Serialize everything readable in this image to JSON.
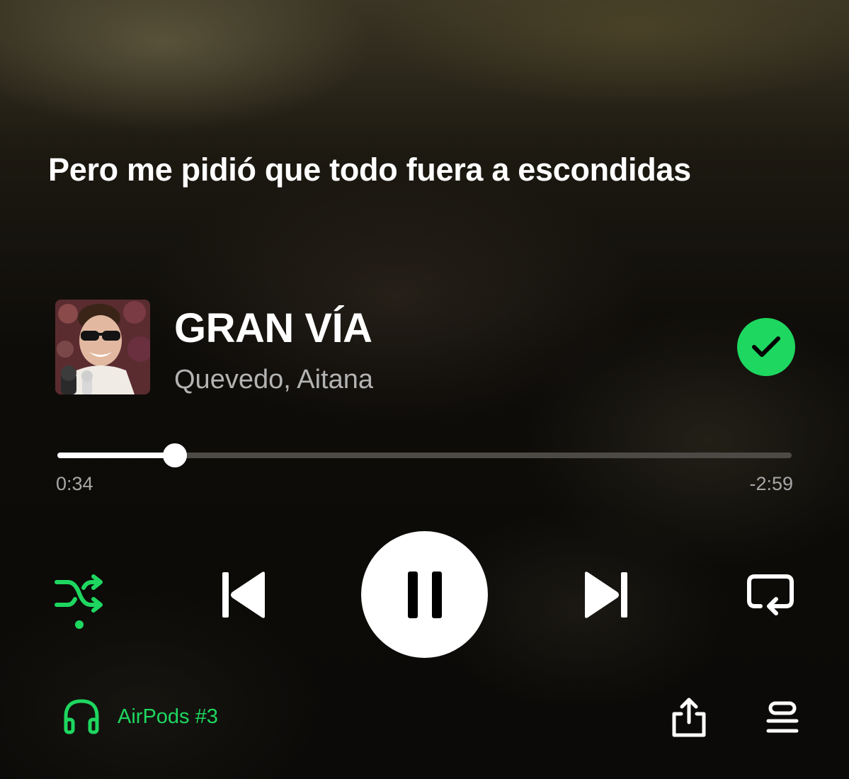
{
  "lyrics": {
    "current_line": "Pero me pidió que todo fuera a escondidas"
  },
  "now_playing": {
    "title": "GRAN VÍA",
    "artist": "Quevedo, Aitana",
    "liked": true,
    "cover_icon": "album-cover-image"
  },
  "playback": {
    "elapsed": "0:34",
    "remaining": "-2:59",
    "progress_fraction": 0.16,
    "state": "playing",
    "shuffle_enabled": true,
    "repeat_enabled": false
  },
  "controls": {
    "shuffle_icon": "shuffle-icon",
    "previous_icon": "skip-previous-icon",
    "pause_icon": "pause-icon",
    "next_icon": "skip-next-icon",
    "repeat_icon": "repeat-icon"
  },
  "footer": {
    "device_label": "AirPods #3",
    "device_icon": "headphones-icon",
    "share_icon": "share-icon",
    "queue_icon": "queue-icon"
  },
  "colors": {
    "accent": "#1ed760",
    "text_primary": "#ffffff",
    "text_secondary": "#b3b3b3",
    "progress_track": "#4d4a45"
  }
}
